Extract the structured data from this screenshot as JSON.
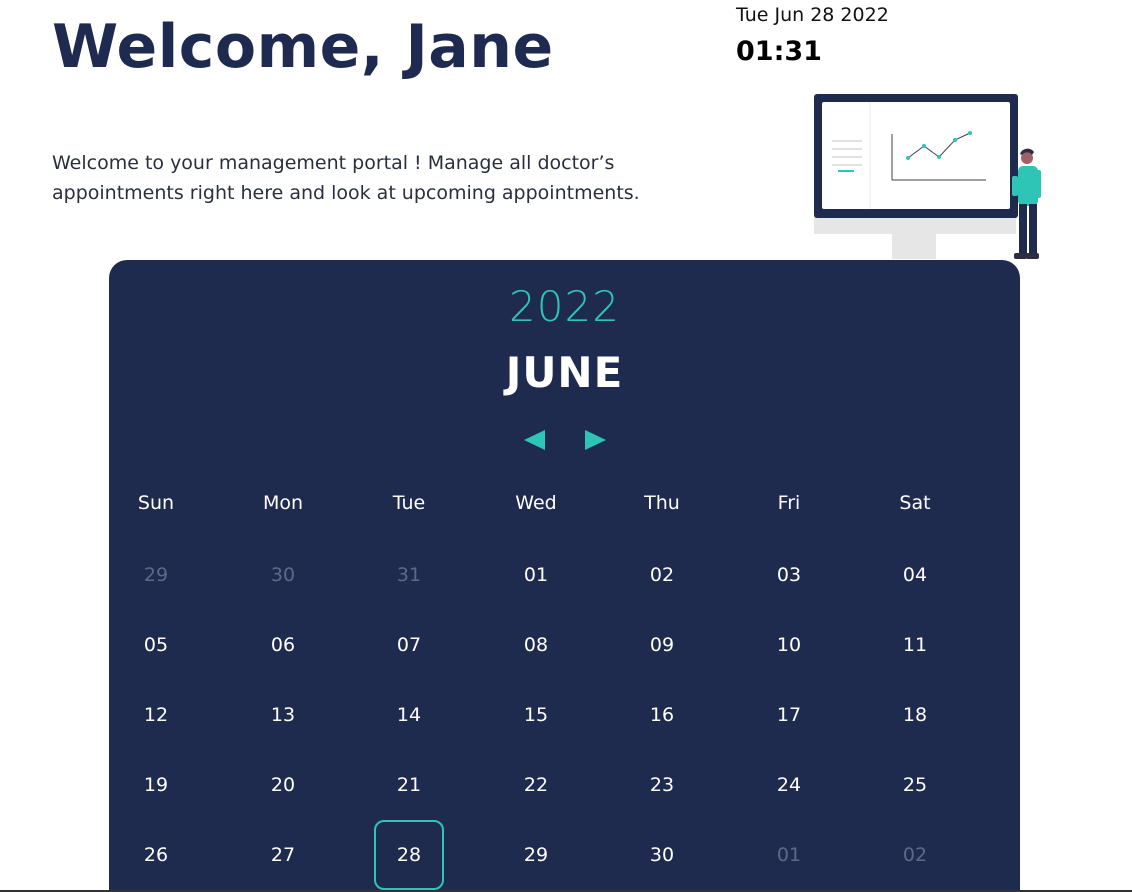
{
  "header": {
    "title": "Welcome, Jane",
    "intro": "Welcome to your management portal ! Manage all doctor’s appointments right here and look at upcoming appointments."
  },
  "clock": {
    "date": "Tue Jun 28 2022",
    "time": "01:31"
  },
  "illustration": {
    "icon": "monitor-with-person-illustration"
  },
  "calendar": {
    "year": "2022",
    "month": "JUNE",
    "prev_icon": "triangle-left-icon",
    "next_icon": "triangle-right-icon",
    "weekdays": [
      "Sun",
      "Mon",
      "Tue",
      "Wed",
      "Thu",
      "Fri",
      "Sat"
    ],
    "weeks": [
      [
        {
          "d": "29",
          "muted": true
        },
        {
          "d": "30",
          "muted": true
        },
        {
          "d": "31",
          "muted": true
        },
        {
          "d": "01"
        },
        {
          "d": "02"
        },
        {
          "d": "03"
        },
        {
          "d": "04"
        }
      ],
      [
        {
          "d": "05"
        },
        {
          "d": "06"
        },
        {
          "d": "07"
        },
        {
          "d": "08"
        },
        {
          "d": "09"
        },
        {
          "d": "10"
        },
        {
          "d": "11"
        }
      ],
      [
        {
          "d": "12"
        },
        {
          "d": "13"
        },
        {
          "d": "14"
        },
        {
          "d": "15"
        },
        {
          "d": "16"
        },
        {
          "d": "17"
        },
        {
          "d": "18"
        }
      ],
      [
        {
          "d": "19"
        },
        {
          "d": "20"
        },
        {
          "d": "21"
        },
        {
          "d": "22"
        },
        {
          "d": "23"
        },
        {
          "d": "24"
        },
        {
          "d": "25"
        }
      ],
      [
        {
          "d": "26"
        },
        {
          "d": "27"
        },
        {
          "d": "28",
          "today": true
        },
        {
          "d": "29"
        },
        {
          "d": "30"
        },
        {
          "d": "01",
          "muted": true
        },
        {
          "d": "02",
          "muted": true
        }
      ]
    ]
  },
  "colors": {
    "navy": "#1f2b4e",
    "accent": "#2ec5b6",
    "muted": "#5d6a86"
  }
}
